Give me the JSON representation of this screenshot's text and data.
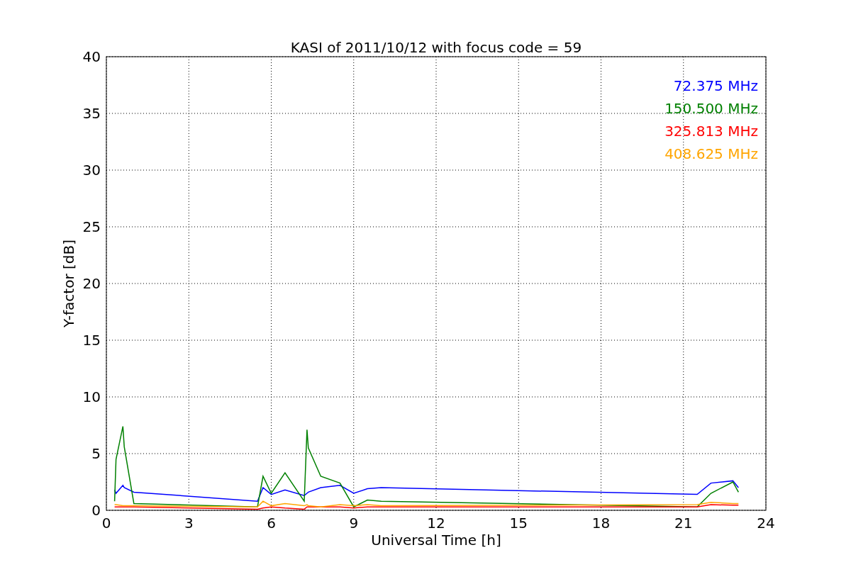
{
  "figure": {
    "chart_data": {
      "type": "line",
      "title": "KASI of 2011/10/12 with focus code = 59",
      "xlabel": "Universal Time [h]",
      "ylabel": "Y-factor [dB]",
      "x": [
        0.3,
        0.35,
        0.6,
        0.65,
        1.0,
        5.5,
        5.7,
        6.0,
        6.5,
        7.2,
        7.3,
        7.35,
        7.8,
        8.5,
        9.0,
        9.5,
        10.0,
        21.5,
        22.0,
        22.8,
        23.0
      ],
      "series": [
        {
          "name": "72.375 MHz",
          "color": "#0000ff",
          "values": [
            1.8,
            1.5,
            2.2,
            2.0,
            1.6,
            0.8,
            2.0,
            1.4,
            1.8,
            1.3,
            1.5,
            1.6,
            2.0,
            2.2,
            1.5,
            1.9,
            2.0,
            1.4,
            2.4,
            2.6,
            2.0
          ]
        },
        {
          "name": "150.500 MHz",
          "color": "#008000",
          "values": [
            0.8,
            4.5,
            7.4,
            5.6,
            0.6,
            0.3,
            3.0,
            1.5,
            3.3,
            0.8,
            7.1,
            5.5,
            3.0,
            2.4,
            0.3,
            0.9,
            0.8,
            0.3,
            1.5,
            2.5,
            1.6
          ]
        },
        {
          "name": "325.813 MHz",
          "color": "#ff0000",
          "values": [
            0.3,
            0.3,
            0.3,
            0.3,
            0.3,
            0.1,
            0.2,
            0.3,
            0.2,
            0.1,
            0.3,
            0.3,
            0.3,
            0.3,
            0.2,
            0.3,
            0.3,
            0.3,
            0.5,
            0.45,
            0.45
          ]
        },
        {
          "name": "408.625 MHz",
          "color": "#ffa500",
          "values": [
            0.5,
            0.5,
            0.4,
            0.4,
            0.4,
            0.3,
            0.8,
            0.4,
            0.6,
            0.4,
            0.5,
            0.4,
            0.3,
            0.5,
            0.4,
            0.5,
            0.4,
            0.5,
            0.7,
            0.6,
            0.6
          ]
        }
      ],
      "xlim": [
        0,
        24
      ],
      "ylim": [
        0,
        40
      ],
      "xticks": [
        0,
        3,
        6,
        9,
        12,
        15,
        18,
        21,
        24
      ],
      "yticks": [
        0,
        5,
        10,
        15,
        20,
        25,
        30,
        35,
        40
      ],
      "grid": true
    }
  }
}
